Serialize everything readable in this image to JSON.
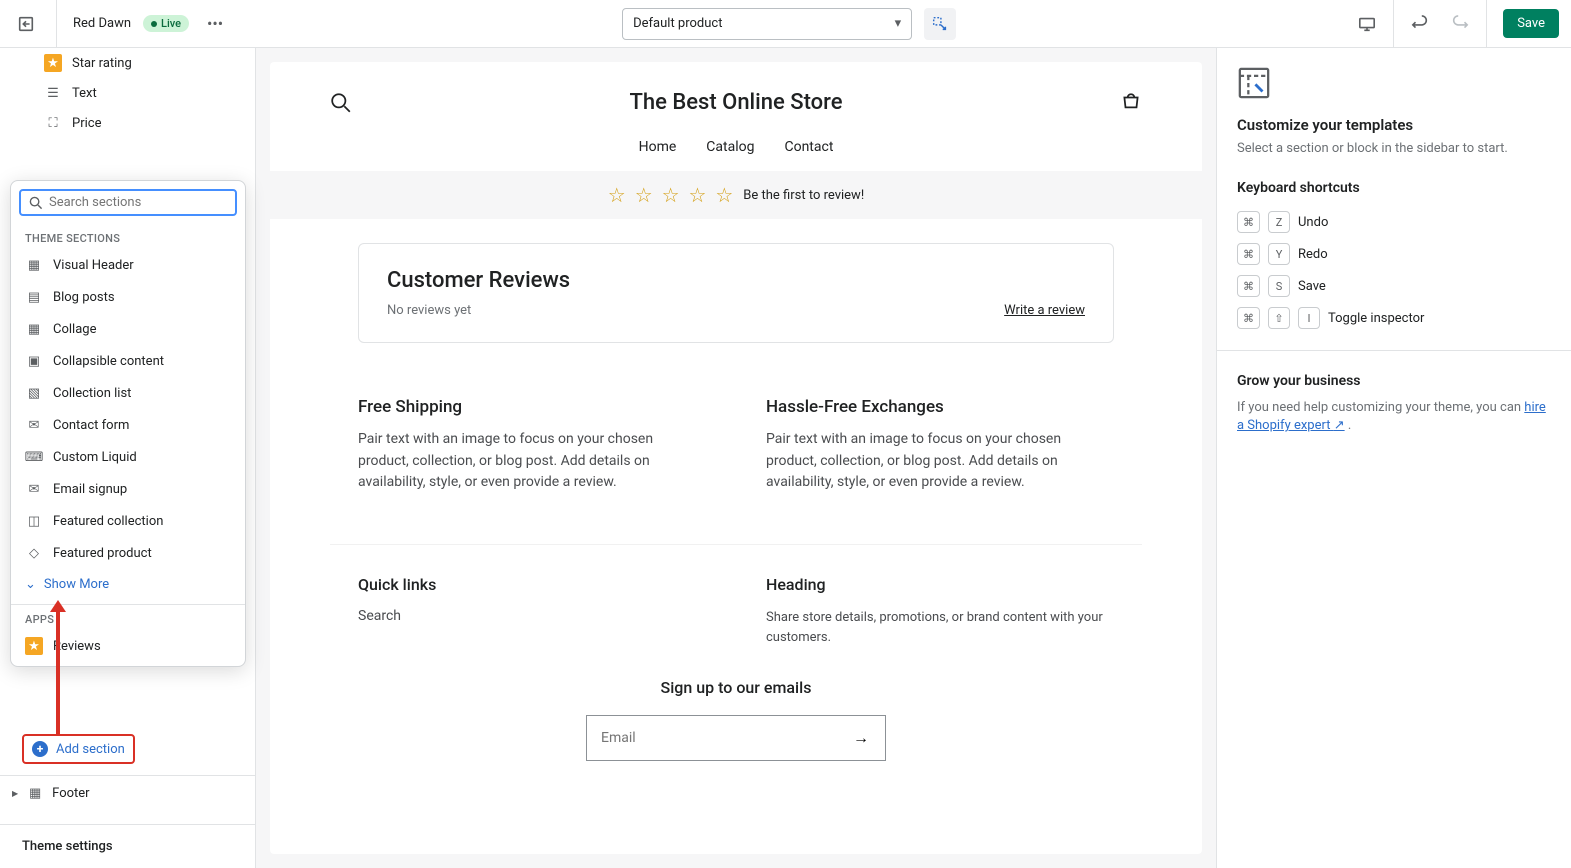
{
  "topbar": {
    "theme_name": "Red Dawn",
    "badge": "Live",
    "template": "Default product",
    "save": "Save"
  },
  "sidebar": {
    "items": [
      "Star rating",
      "Text",
      "Price"
    ],
    "popup": {
      "search_placeholder": "Search sections",
      "heading1": "THEME SECTIONS",
      "theme_sections": [
        "Visual Header",
        "Blog posts",
        "Collage",
        "Collapsible content",
        "Collection list",
        "Contact form",
        "Custom Liquid",
        "Email signup",
        "Featured collection",
        "Featured product"
      ],
      "show_more": "Show More",
      "heading2": "APPS",
      "apps": [
        "Reviews"
      ]
    },
    "add_section": "Add section",
    "footer": "Footer",
    "theme_settings": "Theme settings"
  },
  "preview": {
    "store_title": "The Best Online Store",
    "nav": [
      "Home",
      "Catalog",
      "Contact"
    ],
    "rating_text": "Be the first to review!",
    "reviews_title": "Customer Reviews",
    "no_reviews": "No reviews yet",
    "write_review": "Write a review",
    "features": [
      {
        "title": "Free Shipping",
        "body": "Pair text with an image to focus on your chosen product, collection, or blog post. Add details on availability, style, or even provide a review."
      },
      {
        "title": "Hassle-Free Exchanges",
        "body": "Pair text with an image to focus on your chosen product, collection, or blog post. Add details on availability, style, or even provide a review."
      }
    ],
    "quick_links": {
      "title": "Quick links",
      "link": "Search"
    },
    "heading_col": {
      "title": "Heading",
      "body": "Share store details, promotions, or brand content with your customers."
    },
    "signup_title": "Sign up to our emails",
    "email_placeholder": "Email"
  },
  "right": {
    "customize_title": "Customize your templates",
    "customize_sub": "Select a section or block in the sidebar to start.",
    "kbd_title": "Keyboard shortcuts",
    "shortcuts": [
      {
        "keys": [
          "⌘",
          "Z"
        ],
        "label": "Undo"
      },
      {
        "keys": [
          "⌘",
          "Y"
        ],
        "label": "Redo"
      },
      {
        "keys": [
          "⌘",
          "S"
        ],
        "label": "Save"
      },
      {
        "keys": [
          "⌘",
          "⇧",
          "I"
        ],
        "label": "Toggle inspector"
      }
    ],
    "grow_title": "Grow your business",
    "grow_body": "If you need help customizing your theme, you can ",
    "grow_link": "hire a Shopify expert"
  }
}
